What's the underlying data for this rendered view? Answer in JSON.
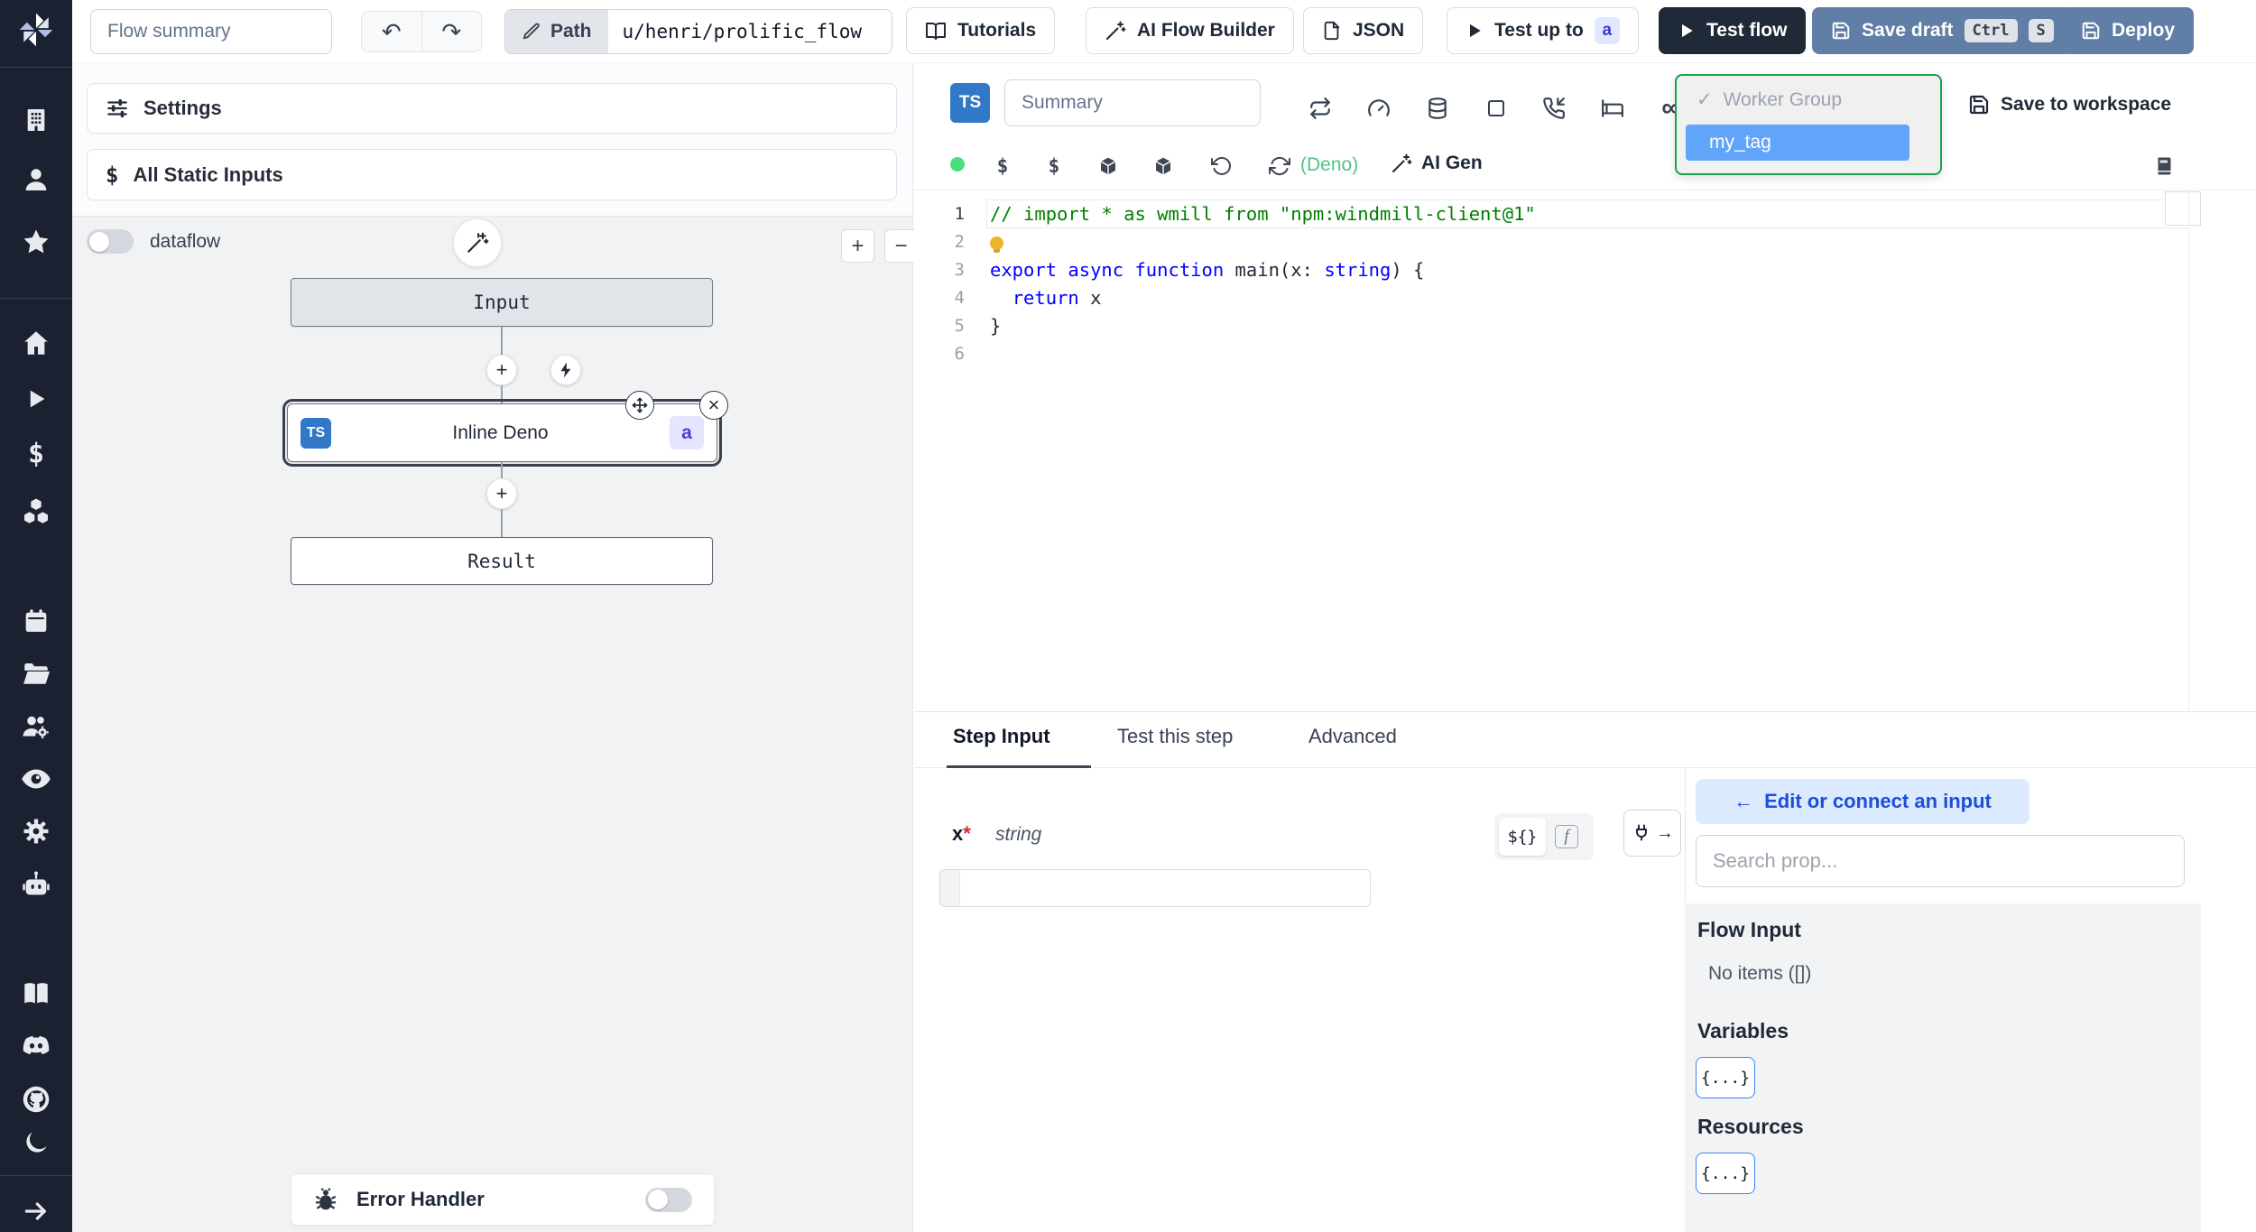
{
  "topbar": {
    "flow_summary_placeholder": "Flow summary",
    "path_label": "Path",
    "path_value": "u/henri/prolific_flow",
    "tutorials_label": "Tutorials",
    "ai_flow_builder_label": "AI Flow Builder",
    "json_label": "JSON",
    "test_up_to_label": "Test up to",
    "test_up_to_badge": "a",
    "test_flow_label": "Test flow",
    "save_draft_label": "Save draft",
    "kbd_ctrl": "Ctrl",
    "kbd_s": "S",
    "deploy_label": "Deploy"
  },
  "flow_panel": {
    "settings_label": "Settings",
    "static_inputs_label": "All Static Inputs",
    "static_inputs_icon": "$",
    "dataflow_label": "dataflow",
    "zoom_in": "+",
    "zoom_out": "−",
    "plus": "+",
    "close": "×",
    "input_node": "Input",
    "ts_badge": "TS",
    "inline_deno_label": "Inline Deno",
    "node_badge": "a",
    "result_node": "Result",
    "error_handler_label": "Error Handler"
  },
  "editor": {
    "ts_badge": "TS",
    "summary_placeholder": "Summary",
    "infinity": "∞",
    "check": "✓",
    "worker_group_label": "Worker Group",
    "selected_tag": "my_tag",
    "save_to_workspace_label": "Save to workspace",
    "dollar1": "$",
    "dollar2": "$",
    "lang_label": "(Deno)",
    "ai_gen_label": "AI Gen"
  },
  "code": {
    "lines": [
      {
        "n": "1",
        "tokens": [
          {
            "c": "cmt",
            "t": "// import * as wmill from \"npm:windmill-client@1\""
          }
        ]
      },
      {
        "n": "2",
        "tokens": [
          {
            "c": "bulb",
            "t": ""
          }
        ]
      },
      {
        "n": "3",
        "tokens": [
          {
            "c": "kw",
            "t": "export"
          },
          {
            "c": "pl",
            "t": " "
          },
          {
            "c": "kw",
            "t": "async"
          },
          {
            "c": "pl",
            "t": " "
          },
          {
            "c": "kw",
            "t": "function"
          },
          {
            "c": "pl",
            "t": " main(x: "
          },
          {
            "c": "kw",
            "t": "string"
          },
          {
            "c": "pl",
            "t": ") {"
          }
        ]
      },
      {
        "n": "4",
        "tokens": [
          {
            "c": "pl",
            "t": "  "
          },
          {
            "c": "kw",
            "t": "return"
          },
          {
            "c": "pl",
            "t": " x"
          }
        ]
      },
      {
        "n": "5",
        "tokens": [
          {
            "c": "pl",
            "t": "}"
          }
        ]
      },
      {
        "n": "6",
        "tokens": []
      }
    ]
  },
  "bottom": {
    "tabs": [
      "Step Input",
      "Test this step",
      "Advanced"
    ],
    "arg_name": "x",
    "required_mark": "*",
    "arg_type": "string",
    "template_toggle": "${}",
    "fn_toggle": "f",
    "plug_arrow": "→",
    "connect_arrow": "←",
    "connect_label": "Edit or connect an input",
    "search_placeholder": "Search prop...",
    "flow_input_title": "Flow Input",
    "no_items": "No items ([])",
    "variables_title": "Variables",
    "resources_title": "Resources",
    "object_chip": "{...}"
  },
  "colors": {
    "sidebar_bg": "#1b2130",
    "accent_blue": "#3178c6",
    "tag_highlight": "#60a5fa",
    "dropdown_green": "#16a34a",
    "slate_button": "#617ea6",
    "dark_button": "#1f2937",
    "status_green": "#4ade80"
  }
}
